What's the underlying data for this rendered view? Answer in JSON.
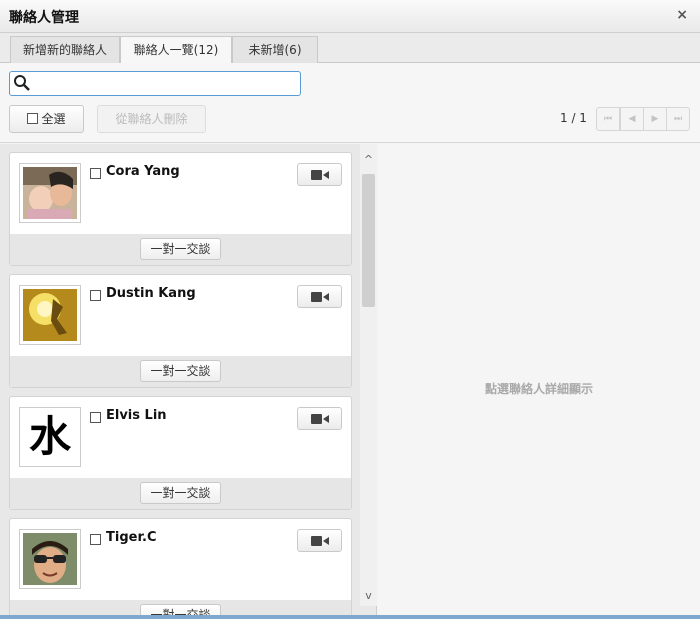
{
  "window": {
    "title": "聯絡人管理",
    "close_label": "×"
  },
  "tabs": [
    {
      "label": "新增新的聯絡人"
    },
    {
      "label": "聯絡人一覽(12)"
    },
    {
      "label": "未新增(6)"
    }
  ],
  "search": {
    "value": "",
    "placeholder": ""
  },
  "actions": {
    "select_all": "全選",
    "delete": "從聯絡人刪除"
  },
  "pagination": {
    "info": "1 / 1",
    "first": "⏮",
    "prev": "◀",
    "next": "▶",
    "last": "⏭"
  },
  "contacts": [
    {
      "name": "Cora Yang",
      "chat_label": "一對一交談"
    },
    {
      "name": "Dustin Kang",
      "chat_label": "一對一交談"
    },
    {
      "name": "Elvis Lin",
      "chat_label": "一對一交談",
      "avatar_char": "水"
    },
    {
      "name": "Tiger.C",
      "chat_label": "一對一交談"
    }
  ],
  "scroll": {
    "up": "^",
    "down": "v"
  },
  "detail": {
    "hint": "點選聯絡人詳細顯示"
  }
}
